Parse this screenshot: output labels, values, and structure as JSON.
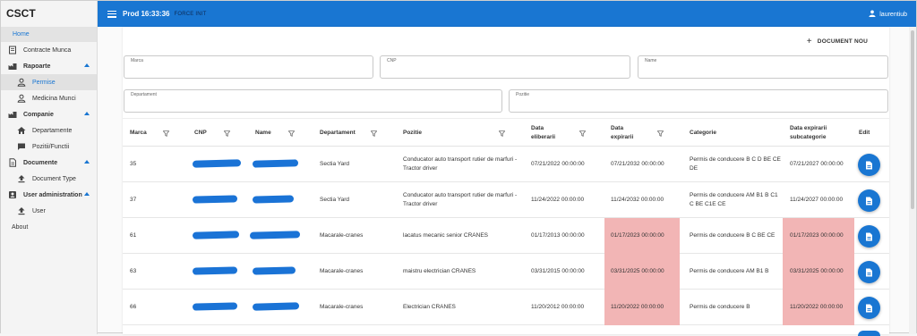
{
  "app": {
    "title": "CSCT"
  },
  "sidebar": {
    "home": "Home",
    "contracte": "Contracte Munca",
    "rapoarte": "Rapoarte",
    "permise": "Permise",
    "medicina": "Medicina Munci",
    "companie": "Companie",
    "departamente": "Departamente",
    "pozitii": "Pozitii/Functii",
    "documente": "Documente",
    "doctype": "Document Type",
    "useradmin": "User administration",
    "user": "User",
    "about": "About"
  },
  "topbar": {
    "env": "Prod 16:33:36",
    "force": "FORCE INIT",
    "username": "laurentiub"
  },
  "actions": {
    "new_document": "DOCUMENT NOU"
  },
  "filters": {
    "marca": "Marca",
    "cnp": "CNP",
    "name": "Name",
    "departament": "Departament",
    "pozitie": "Pozitie"
  },
  "table": {
    "headers": {
      "marca": "Marca",
      "cnp": "CNP",
      "name": "Name",
      "departament": "Departament",
      "pozitie": "Pozitie",
      "data_eliberarii_1": "Data",
      "data_eliberarii_2": "eliberarii",
      "data_expirarii_1": "Data",
      "data_expirarii_2": "expirarii",
      "categorie": "Categorie",
      "data_expirarii_sub_1": "Data expirarii",
      "data_expirarii_sub_2": "subcategorie",
      "edit": "Edit"
    },
    "rows": [
      {
        "marca": "35",
        "departament": "Sectia Yard",
        "pozitie": "Conducator auto transport rutier de marfuri - Tractor driver",
        "data_eliberarii": "07/21/2022 00:00:00",
        "data_expirarii": "07/21/2032 00:00:00",
        "categorie": "Permis de conducere B C D BE CE DE",
        "data_expirarii_sub": "07/21/2027 00:00:00",
        "expired": false,
        "sub_expired": false
      },
      {
        "marca": "37",
        "departament": "Sectia Yard",
        "pozitie": "Conducator auto transport rutier de marfuri - Tractor driver",
        "data_eliberarii": "11/24/2022 00:00:00",
        "data_expirarii": "11/24/2032 00:00:00",
        "categorie": "Permis de conducere AM B1 B C1 C BE C1E CE",
        "data_expirarii_sub": "11/24/2027 00:00:00",
        "expired": false,
        "sub_expired": false
      },
      {
        "marca": "61",
        "departament": "Macarale-cranes",
        "pozitie": "lacatus mecanic senior CRANES",
        "data_eliberarii": "01/17/2013 00:00:00",
        "data_expirarii": "01/17/2023 00:00:00",
        "categorie": "Permis de conducere B C BE CE",
        "data_expirarii_sub": "01/17/2023 00:00:00",
        "expired": true,
        "sub_expired": true
      },
      {
        "marca": "63",
        "departament": "Macarale-cranes",
        "pozitie": "maistru electrician CRANES",
        "data_eliberarii": "03/31/2015 00:00:00",
        "data_expirarii": "03/31/2025 00:00:00",
        "categorie": "Permis de conducere AM B1 B",
        "data_expirarii_sub": "03/31/2025 00:00:00",
        "expired": true,
        "sub_expired": true
      },
      {
        "marca": "66",
        "departament": "Macarale-cranes",
        "pozitie": "Electrician CRANES",
        "data_eliberarii": "11/20/2012 00:00:00",
        "data_expirarii": "11/20/2022 00:00:00",
        "categorie": "Permis de conducere B",
        "data_expirarii_sub": "11/20/2022 00:00:00",
        "expired": true,
        "sub_expired": true
      }
    ]
  },
  "colors": {
    "primary": "#1976d2",
    "expired": "#f2b5b5",
    "redaction": "#1a73d6"
  }
}
